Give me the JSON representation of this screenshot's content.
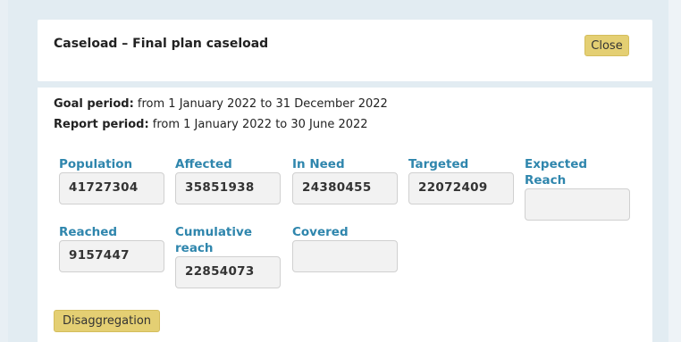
{
  "header": {
    "title": "Caseload – Final plan caseload",
    "close_label": "Close"
  },
  "periods": {
    "goal_label": "Goal period:",
    "goal_value": " from 1 January 2022 to 31 December 2022",
    "report_label": "Report period:",
    "report_value": " from 1 January 2022 to 30 June 2022"
  },
  "fields": {
    "population": {
      "label": "Population",
      "value": "41727304"
    },
    "affected": {
      "label": "Affected",
      "value": "35851938"
    },
    "in_need": {
      "label": "In Need",
      "value": "24380455"
    },
    "targeted": {
      "label": "Targeted",
      "value": "22072409"
    },
    "expected_reach": {
      "label": "Expected Reach",
      "value": ""
    },
    "reached": {
      "label": "Reached",
      "value": "9157447"
    },
    "cumulative_reach": {
      "label": "Cumulative reach",
      "value": "22854073"
    },
    "covered": {
      "label": "Covered",
      "value": ""
    }
  },
  "disaggregation_label": "Disaggregation",
  "colors": {
    "accent_label": "#2f86ad",
    "button_bg": "#e4cf73",
    "page_bg": "#e2ecf2"
  }
}
